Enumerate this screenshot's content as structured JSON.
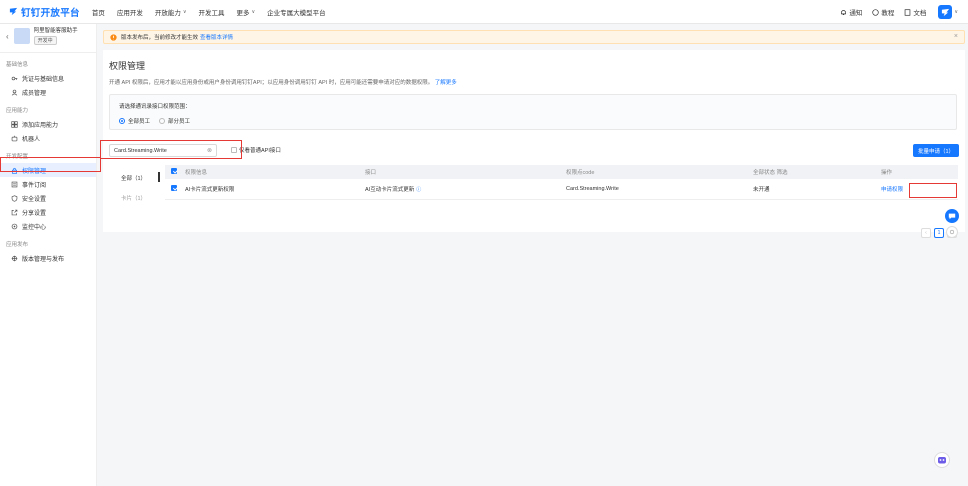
{
  "brand": {
    "logo_text": "钉钉开放平台",
    "accent": "#1677ff"
  },
  "nav": {
    "items": [
      {
        "label": "首页"
      },
      {
        "label": "应用开发"
      },
      {
        "label": "开放能力",
        "chevron": true
      },
      {
        "label": "开发工具"
      },
      {
        "label": "更多",
        "chevron": true
      },
      {
        "label": "企业专属大模型平台"
      }
    ],
    "right": {
      "notify": "通知",
      "tutorial": "教程",
      "docs": "文档"
    }
  },
  "sidebar": {
    "app_name": "阿里智能客服助手",
    "app_status": "开发中",
    "groups": [
      {
        "title": "基础信息",
        "items": [
          {
            "label": "凭证与基础信息",
            "icon": "key-icon"
          },
          {
            "label": "成员管理",
            "icon": "user-icon"
          }
        ]
      },
      {
        "title": "应用能力",
        "items": [
          {
            "label": "添加应用能力",
            "icon": "grid-icon"
          },
          {
            "label": "机器人",
            "icon": "robot-icon"
          }
        ]
      },
      {
        "title": "开发配置",
        "items": [
          {
            "label": "权限管理",
            "icon": "lock-icon",
            "active": true
          },
          {
            "label": "事件订阅",
            "icon": "event-icon"
          },
          {
            "label": "安全设置",
            "icon": "shield-icon"
          },
          {
            "label": "分享设置",
            "icon": "share-icon"
          },
          {
            "label": "监控中心",
            "icon": "monitor-icon"
          }
        ]
      },
      {
        "title": "应用发布",
        "items": [
          {
            "label": "版本管理与发布",
            "icon": "version-icon"
          }
        ]
      }
    ]
  },
  "notice": {
    "text": "版本发布后，当前修改才能生效",
    "link": "查看版本详情"
  },
  "page": {
    "title": "权限管理",
    "desc": "开通 API 权限后，应用才能以应用身份或用户身份调用钉钉API；以应用身份调用钉钉 API 时，应用可能还需要申请对应的数据权限。",
    "desc_link": "了解更多"
  },
  "scope": {
    "label": "请选择通讯录接口权限范围：",
    "options": [
      {
        "label": "全部员工",
        "selected": true
      },
      {
        "label": "部分员工",
        "selected": false
      }
    ]
  },
  "filter": {
    "search_value": "Card.Streaming.Write",
    "only_selected_label": "仅看普通API接口",
    "batch_button": "批量申请（1）"
  },
  "categories": [
    {
      "label": "全部（1）",
      "active": true
    },
    {
      "label": "卡片（1）",
      "active": false
    }
  ],
  "table": {
    "headers": {
      "name": "权限信息",
      "api": "接口",
      "code": "权限点code",
      "status": "全部状态  筛选",
      "op": "操作"
    },
    "rows": [
      {
        "name": "AI卡片流式更新权限",
        "api": "AI互动卡片流式更新",
        "code": "Card.Streaming.Write",
        "status": "未开通",
        "op": "申请权限"
      }
    ]
  },
  "pager": {
    "prev": "‹",
    "current": "1",
    "next": "›"
  }
}
